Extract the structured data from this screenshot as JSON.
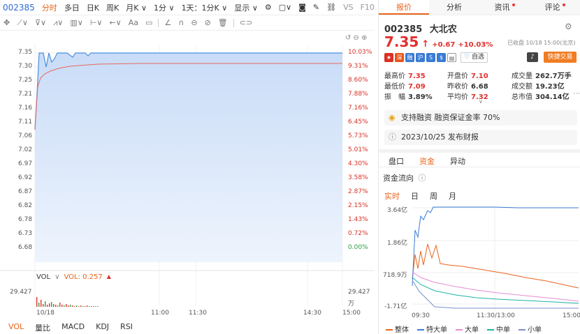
{
  "toolbar": {
    "code": "002385",
    "items": [
      "分时",
      "多日",
      "日K",
      "周K",
      "月K ∨",
      "1分 ∨",
      "1天：1分K ∨",
      "显示 ∨"
    ],
    "vs": "VS",
    "f10": "F10"
  },
  "chart": {
    "y_left": [
      "7.35",
      "7.30",
      "7.25",
      "7.21",
      "7.16",
      "7.11",
      "7.06",
      "7.02",
      "6.97",
      "6.92",
      "6.87",
      "6.82",
      "6.78",
      "6.73",
      "6.68"
    ],
    "y_right": [
      "10.03%",
      "9.31%",
      "8.60%",
      "7.88%",
      "7.16%",
      "6.45%",
      "5.73%",
      "5.01%",
      "4.30%",
      "3.58%",
      "2.87%",
      "2.15%",
      "1.43%",
      "0.72%",
      "0.00%"
    ],
    "vol_label": "VOL",
    "vol_value": "VOL: 0.257",
    "vol_max_left": "29.427",
    "vol_max_right": "29.427",
    "vol_unit": "万",
    "x_labels": [
      "10/18",
      "11:00",
      "11:30",
      "14:30",
      "15:00"
    ],
    "price_color": "#4a90e2",
    "avg_color": "#e56b5c"
  },
  "bottom_tabs": [
    "VOL",
    "量比",
    "MACD",
    "KDJ",
    "RSI"
  ],
  "panel": {
    "tabs": [
      "报价",
      "分析",
      "资讯",
      "评论"
    ],
    "code": "002385",
    "name": "大北农",
    "price": "7.35",
    "arrow": "↑",
    "change": "+0.67",
    "change_pct": "+10.03%",
    "status": "已收盘 10/18 15:00(北京)",
    "self_select": "自选",
    "quick_trade": "快捷交易",
    "badges": [
      "深",
      "融",
      "沪",
      "S",
      "$"
    ],
    "stats": [
      [
        {
          "k": "最高价",
          "v": "7.35",
          "c": "red"
        },
        {
          "k": "开盘价",
          "v": "7.10",
          "c": "red"
        },
        {
          "k": "成交量",
          "v": "262.7万手",
          "c": ""
        }
      ],
      [
        {
          "k": "最低价",
          "v": "7.09",
          "c": "red"
        },
        {
          "k": "昨收价",
          "v": "6.68",
          "c": ""
        },
        {
          "k": "成交额",
          "v": "19.23亿",
          "c": ""
        }
      ],
      [
        {
          "k": "振　幅",
          "v": "3.89%",
          "c": ""
        },
        {
          "k": "平均价",
          "v": "7.32",
          "c": "red"
        },
        {
          "k": "总市值",
          "v": "304.14亿",
          "c": ""
        }
      ]
    ],
    "info1": "支持融资 融资保证金率 70%",
    "info2": "2023/10/25  发布财报",
    "subtabs": [
      "盘口",
      "资金",
      "异动"
    ],
    "flow_title": "资金流向",
    "flow_tabs": [
      "实时",
      "日",
      "周",
      "月"
    ],
    "flow_y": [
      "3.64亿",
      "1.86亿",
      "718.9万",
      "-1.71亿"
    ],
    "flow_x": [
      "09:30",
      "11:30/13:00",
      "15:00"
    ],
    "legend": [
      {
        "name": "整体",
        "color": "#e8641b"
      },
      {
        "name": "特大单",
        "color": "#3a7bd5"
      },
      {
        "name": "大单",
        "color": "#e48bd6"
      },
      {
        "name": "中单",
        "color": "#1fb3a6"
      },
      {
        "name": "小单",
        "color": "#7b8fc9"
      }
    ]
  }
}
